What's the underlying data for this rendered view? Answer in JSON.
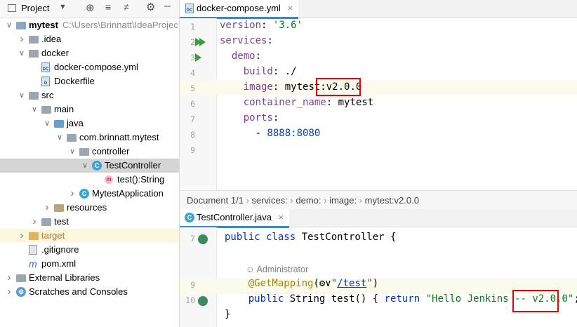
{
  "project_panel": {
    "title": "Project",
    "tree": [
      {
        "label": "mytest",
        "extra": "C:\\Users\\Brinnatt\\IdeaProjec",
        "depth": 0,
        "expanded": true,
        "icon": "module-folder-icon"
      },
      {
        "label": ".idea",
        "depth": 1,
        "expanded": false,
        "icon": "folder-icon"
      },
      {
        "label": "docker",
        "depth": 1,
        "expanded": true,
        "icon": "folder-icon"
      },
      {
        "label": "docker-compose.yml",
        "depth": 2,
        "icon": "docker-compose-file-icon"
      },
      {
        "label": "Dockerfile",
        "depth": 2,
        "icon": "dockerfile-icon"
      },
      {
        "label": "src",
        "depth": 1,
        "expanded": true,
        "icon": "folder-icon"
      },
      {
        "label": "main",
        "depth": 2,
        "expanded": true,
        "icon": "folder-icon"
      },
      {
        "label": "java",
        "depth": 3,
        "expanded": true,
        "icon": "source-folder-icon"
      },
      {
        "label": "com.brinnatt.mytest",
        "depth": 4,
        "expanded": true,
        "icon": "package-icon"
      },
      {
        "label": "controller",
        "depth": 5,
        "expanded": true,
        "icon": "package-icon"
      },
      {
        "label": "TestController",
        "depth": 6,
        "expanded": true,
        "icon": "class-icon",
        "selected": true
      },
      {
        "label": "test():String",
        "depth": 7,
        "icon": "method-icon"
      },
      {
        "label": "MytestApplication",
        "depth": 5,
        "expanded": false,
        "icon": "spring-class-icon"
      },
      {
        "label": "resources",
        "depth": 3,
        "expanded": false,
        "icon": "resources-folder-icon"
      },
      {
        "label": "test",
        "depth": 2,
        "expanded": false,
        "icon": "folder-icon"
      },
      {
        "label": "target",
        "depth": 1,
        "expanded": false,
        "icon": "excluded-folder-icon",
        "highlight": true
      },
      {
        "label": ".gitignore",
        "depth": 1,
        "icon": "gitignore-file-icon"
      },
      {
        "label": "pom.xml",
        "depth": 1,
        "icon": "maven-file-icon"
      },
      {
        "label": "External Libraries",
        "depth": 0,
        "expanded": false,
        "icon": "libraries-icon"
      },
      {
        "label": "Scratches and Consoles",
        "depth": 0,
        "expanded": false,
        "icon": "scratches-icon"
      }
    ]
  },
  "top_editor": {
    "tab_label": "docker-compose.yml",
    "lines": [
      {
        "n": "1",
        "parts": [
          [
            "key",
            "version"
          ],
          [
            "plain",
            ": "
          ],
          [
            "str",
            "'3.6'"
          ]
        ]
      },
      {
        "n": "2",
        "parts": [
          [
            "key",
            "services"
          ],
          [
            "plain",
            ":"
          ]
        ]
      },
      {
        "n": "3",
        "parts": [
          [
            "plain",
            "  "
          ],
          [
            "key",
            "demo"
          ],
          [
            "plain",
            ":"
          ]
        ]
      },
      {
        "n": "4",
        "parts": [
          [
            "plain",
            "    "
          ],
          [
            "key",
            "build"
          ],
          [
            "plain",
            ": ./"
          ]
        ]
      },
      {
        "n": "5",
        "parts": [
          [
            "plain",
            "    "
          ],
          [
            "key",
            "image"
          ],
          [
            "plain",
            ": mytest:v2.0.0"
          ]
        ]
      },
      {
        "n": "6",
        "parts": [
          [
            "plain",
            "    "
          ],
          [
            "key",
            "container_name"
          ],
          [
            "plain",
            ": mytest"
          ]
        ]
      },
      {
        "n": "7",
        "parts": [
          [
            "plain",
            "    "
          ],
          [
            "key",
            "ports"
          ],
          [
            "plain",
            ":"
          ]
        ]
      },
      {
        "n": "8",
        "parts": [
          [
            "plain",
            "      - "
          ],
          [
            "num",
            "8888:8080"
          ]
        ]
      },
      {
        "n": "9",
        "parts": []
      }
    ],
    "breadcrumbs": [
      "Document 1/1",
      "services:",
      "demo:",
      "image:",
      "mytest:v2.0.0"
    ]
  },
  "bottom_editor": {
    "tab_label": "TestController.java",
    "lines": [
      {
        "n": "7",
        "parts": [
          [
            "kw",
            "public class "
          ],
          [
            "plain",
            "TestController {"
          ]
        ]
      },
      {
        "n": "",
        "parts": []
      },
      {
        "n": "",
        "author": "Administrator"
      },
      {
        "n": "9",
        "parts": [
          [
            "plain",
            "    "
          ],
          [
            "ann",
            "@GetMapping"
          ],
          [
            "plain",
            "("
          ],
          [
            "plain",
            "⚙∨"
          ],
          [
            "str",
            "\""
          ],
          [
            "link",
            "/test"
          ],
          [
            "str",
            "\""
          ],
          [
            "plain",
            ")"
          ]
        ]
      },
      {
        "n": "10",
        "parts": [
          [
            "plain",
            "    "
          ],
          [
            "kw",
            "public "
          ],
          [
            "plain",
            "String test() { "
          ],
          [
            "kw",
            "return "
          ],
          [
            "str",
            "\"Hello Jenkins -- v2.0.0\""
          ],
          [
            "plain",
            "; }"
          ]
        ]
      },
      {
        "n": "",
        "parts": [
          [
            "plain",
            "}"
          ]
        ]
      }
    ]
  },
  "colors": {
    "accent": "#4083c9",
    "highlight_box": "#e00000",
    "selection": "#d5d5d5"
  }
}
